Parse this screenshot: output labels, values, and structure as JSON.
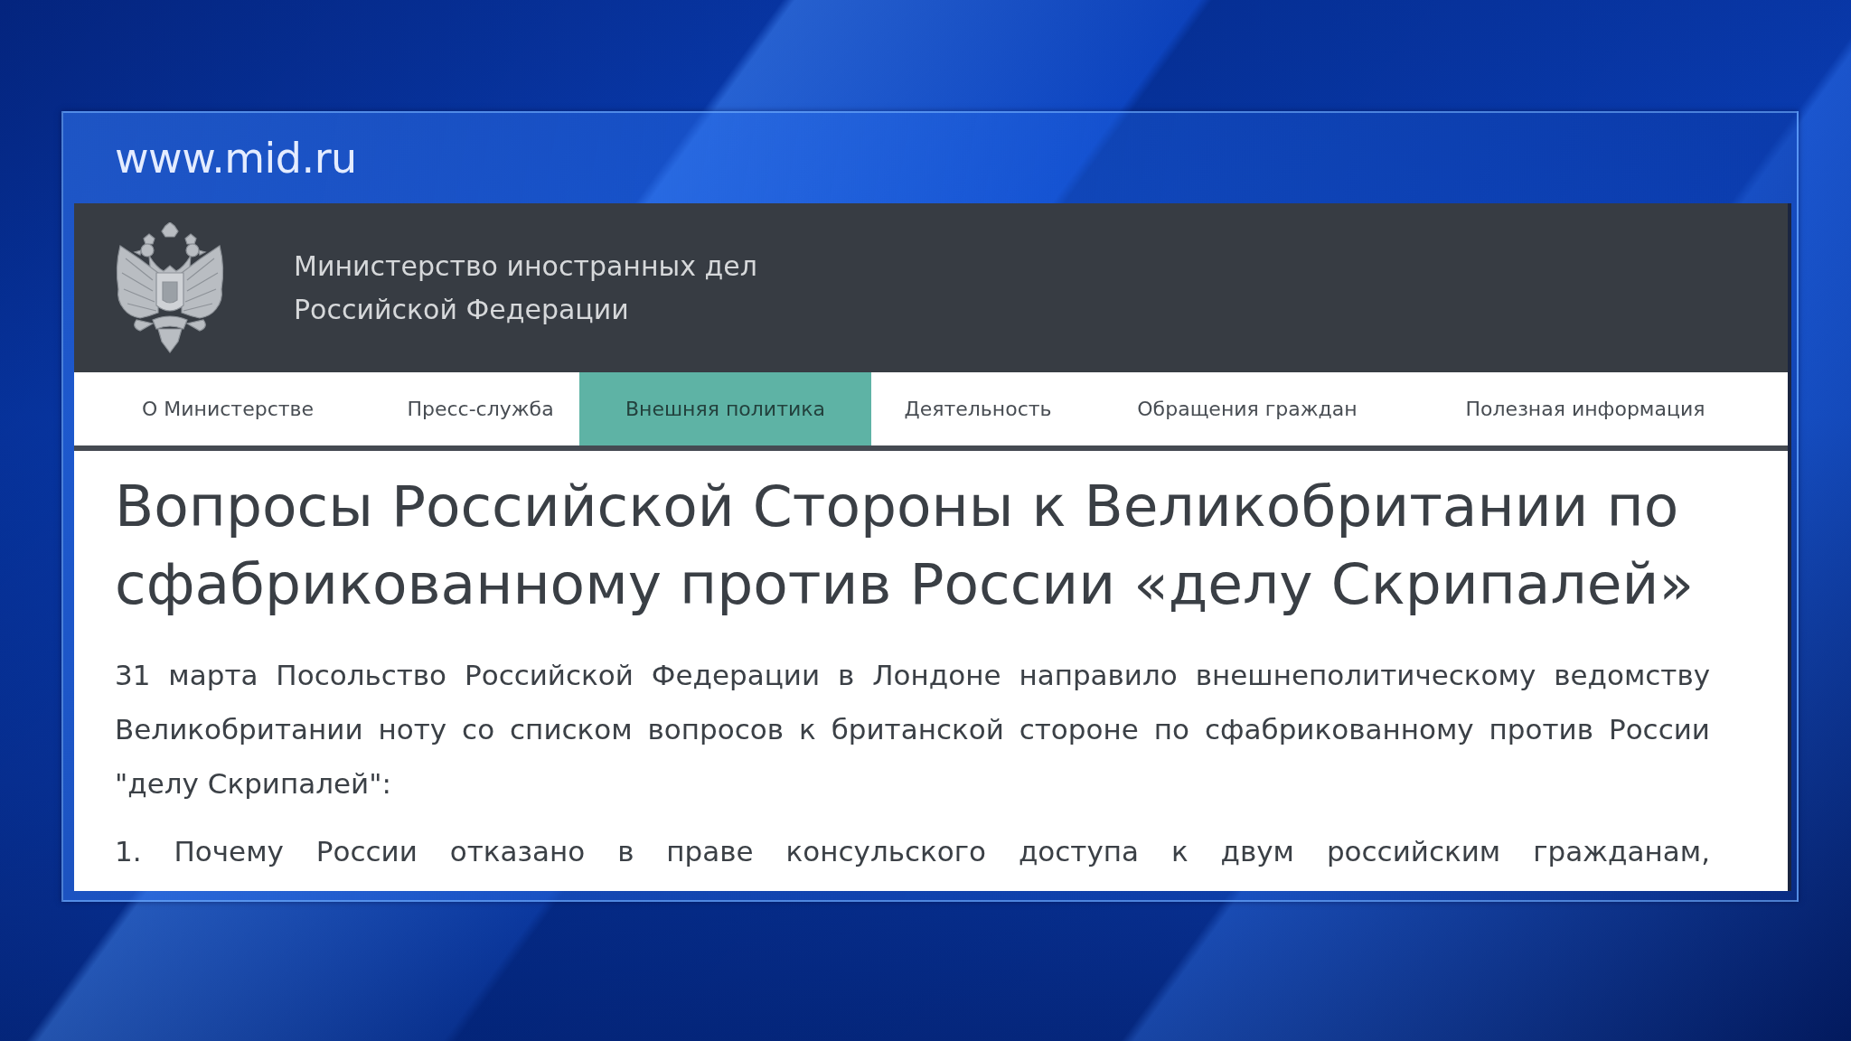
{
  "overlay": {
    "url": "www.mid.ru"
  },
  "site_header": {
    "title": "Министерство иностранных дел Российской Федерации"
  },
  "nav": [
    {
      "label": "О Министерстве",
      "selected": false
    },
    {
      "label": "Пресс-служба",
      "selected": false
    },
    {
      "label": "Внешняя политика",
      "selected": true
    },
    {
      "label": "Деятельность",
      "selected": false
    },
    {
      "label": "Обращения граждан",
      "selected": false
    },
    {
      "label": "Полезная информация",
      "selected": false
    }
  ],
  "article": {
    "title": "Вопросы Российской Стороны к Великобритании по сфабрикованному против России «делу Скрипалей»",
    "paragraphs": [
      {
        "kind": "lead",
        "text": "31 марта Посольство Российской Федерации в Лондоне направило внешнеполитическому ведомству Великобритании ноту со списком вопросов к британской стороне по сфабрикованному против России \"делу Скрипалей\":"
      },
      {
        "kind": "list_item",
        "text": "1. Почему России отказано в праве консульского доступа к двум российским гражданам,"
      }
    ]
  }
}
